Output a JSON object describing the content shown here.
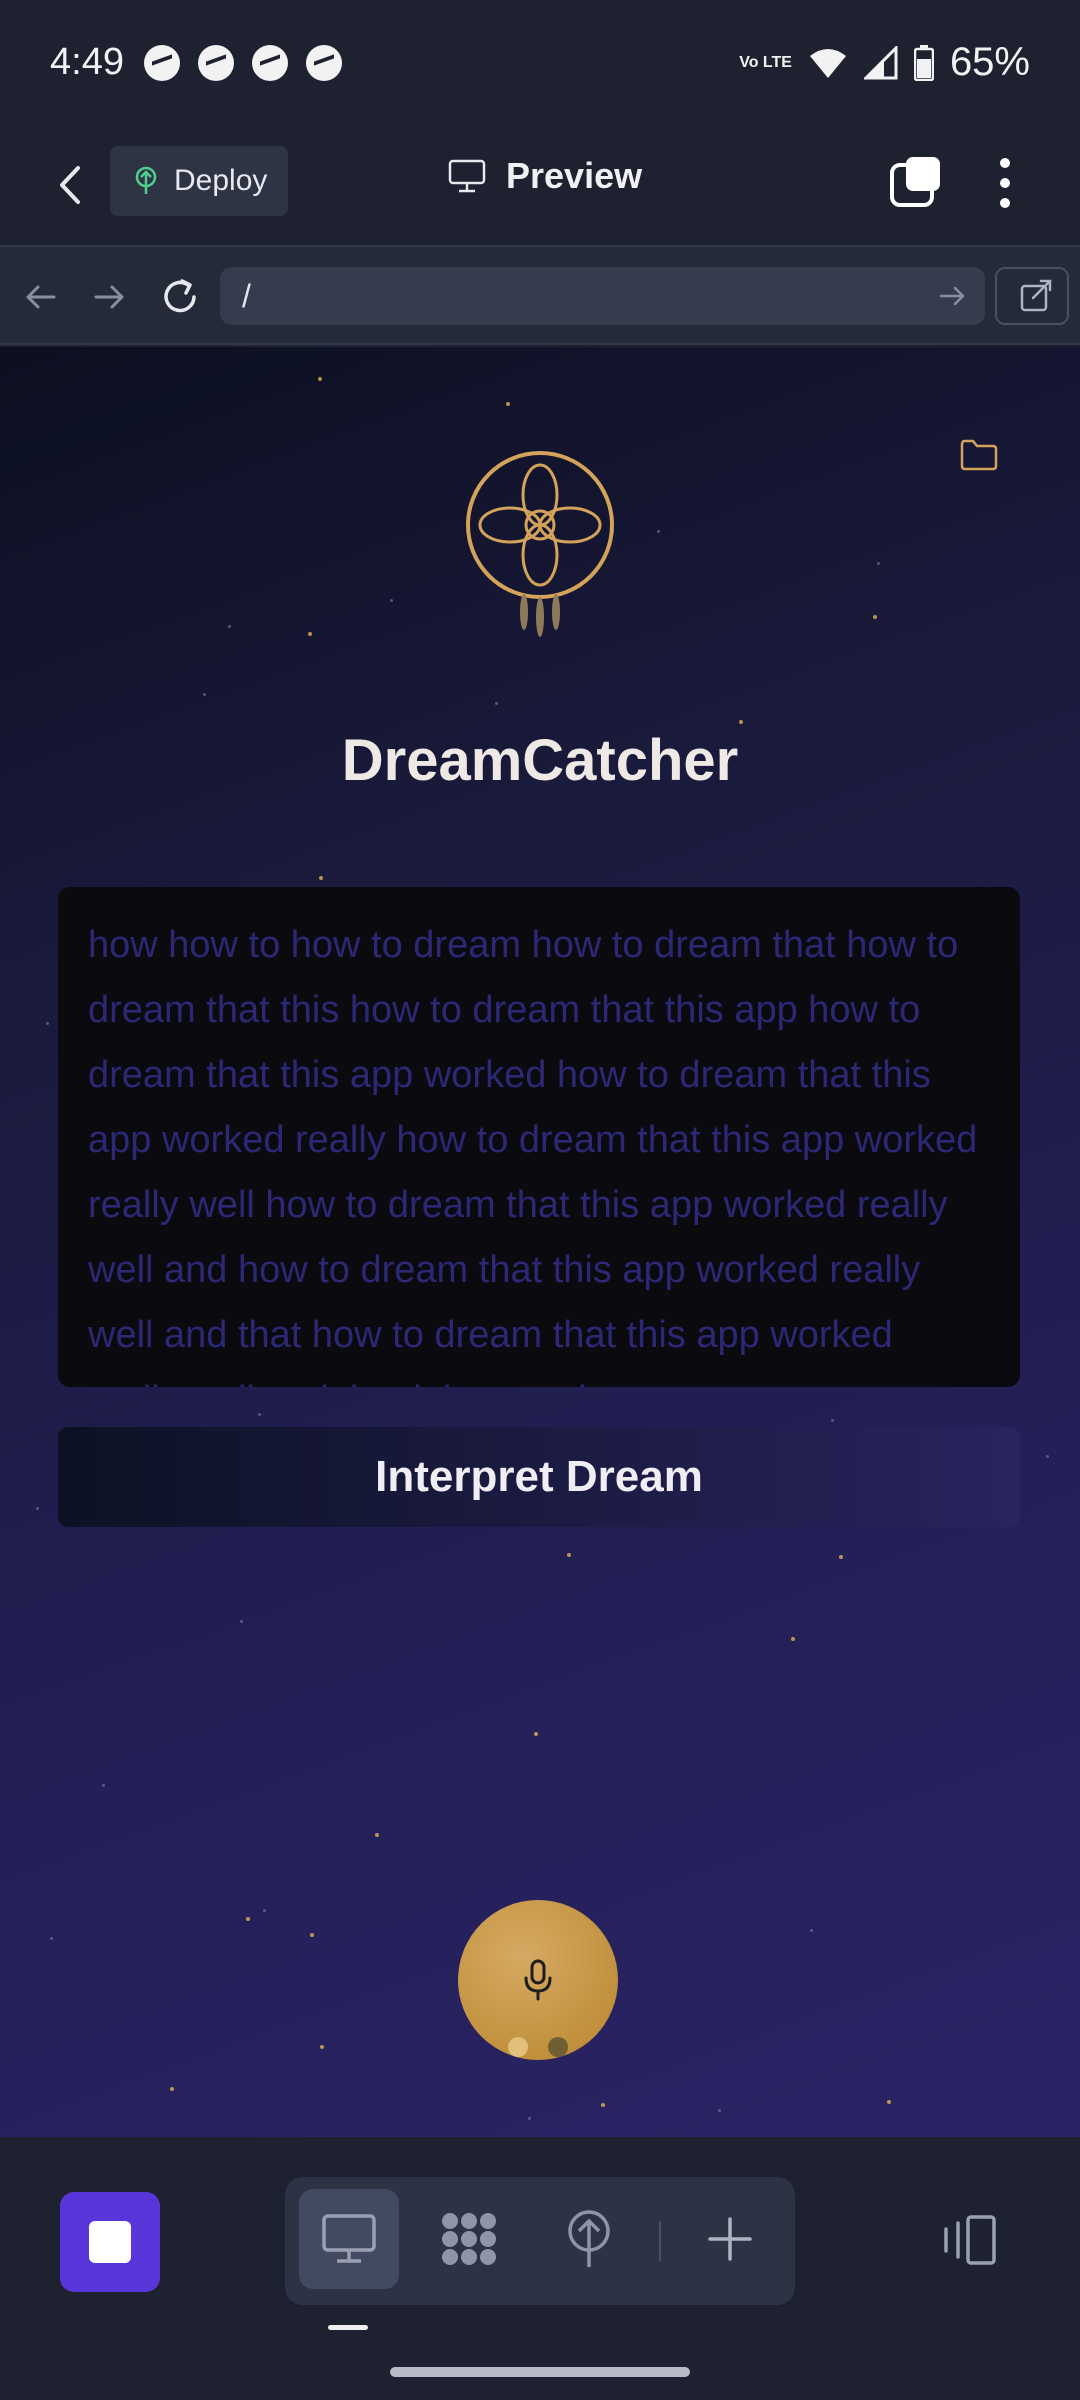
{
  "status_bar": {
    "time": "4:49",
    "notification_icons": [
      "messenger-icon",
      "messenger-icon",
      "messenger-icon",
      "messenger-icon"
    ],
    "network_label": "Vo LTE",
    "battery": "65%"
  },
  "toolbar": {
    "deploy_label": "Deploy",
    "title": "Preview"
  },
  "url_bar": {
    "value": "/"
  },
  "app": {
    "title": "DreamCatcher",
    "dream_text": "how how to how to dream how to dream that how to dream that this how to dream that this app how to dream that this app worked how to dream that this app worked really how to dream that this app worked really well how to dream that this app worked really well and how to dream that this app worked really well and that how to dream that this app worked really well and that it how to dream",
    "interpret_label": "Interpret Dream"
  },
  "colors": {
    "accent": "#5936d9",
    "gold": "#d4a35a",
    "text_faint": "#2c2875"
  }
}
